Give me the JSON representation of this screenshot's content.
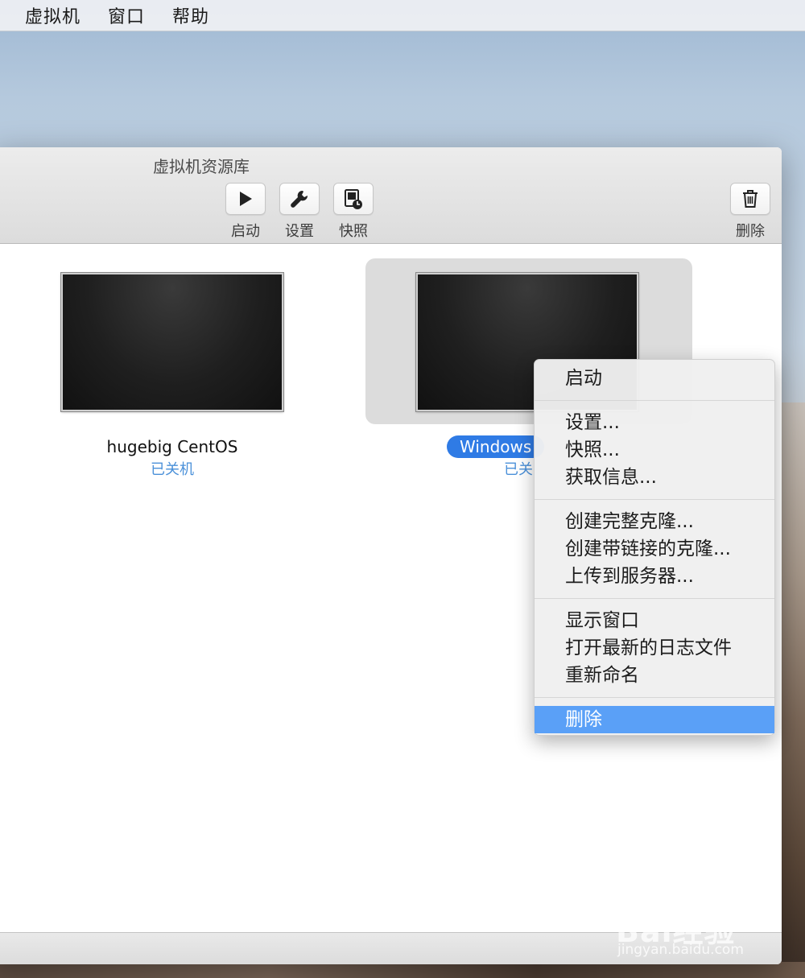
{
  "menubar": {
    "items": [
      "虚拟机",
      "窗口",
      "帮助"
    ]
  },
  "window": {
    "title": "虚拟机资源库",
    "toolbar": {
      "start_label": "启动",
      "settings_label": "设置",
      "snapshot_label": "快照",
      "delete_label": "删除"
    },
    "vms": [
      {
        "name": "hugebig CentOS",
        "status": "已关机"
      },
      {
        "name": "Windows",
        "status": "已关"
      }
    ]
  },
  "context_menu": {
    "items": [
      "启动",
      "设置...",
      "快照...",
      "获取信息...",
      "创建完整克隆...",
      "创建带链接的克隆...",
      "上传到服务器...",
      "显示窗口",
      "打开最新的日志文件",
      "重新命名",
      "删除"
    ],
    "highlight_color": "#5aa0f7"
  },
  "watermark": {
    "brand": "Bai经验",
    "url": "jingyan.baidu.com"
  },
  "colors": {
    "selection_blue": "#2f7be5",
    "status_blue": "#4a90d9"
  }
}
